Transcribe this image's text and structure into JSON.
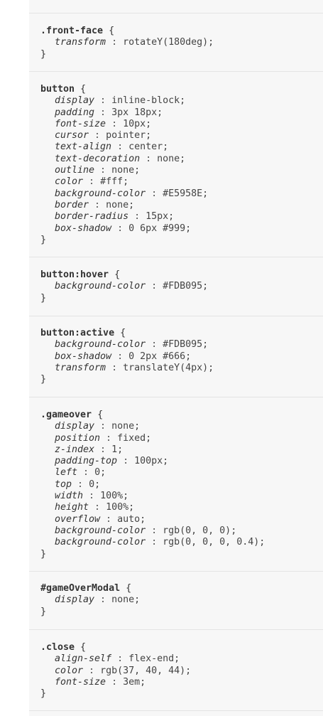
{
  "rules": [
    {
      "selector": ".front-face",
      "declarations": [
        {
          "property": "transform",
          "value": "rotateY(180deg);"
        }
      ]
    },
    {
      "selector": "button",
      "declarations": [
        {
          "property": "display",
          "value": "inline-block;"
        },
        {
          "property": "padding",
          "value": "3px 18px;"
        },
        {
          "property": "font-size",
          "value": "10px;"
        },
        {
          "property": "cursor",
          "value": "pointer;"
        },
        {
          "property": "text-align",
          "value": "center;"
        },
        {
          "property": "text-decoration",
          "value": "none;"
        },
        {
          "property": "outline",
          "value": "none;"
        },
        {
          "property": "color",
          "value": "#fff;"
        },
        {
          "property": "background-color",
          "value": "#E5958E;"
        },
        {
          "property": "border",
          "value": "none;"
        },
        {
          "property": "border-radius",
          "value": "15px;"
        },
        {
          "property": "box-shadow",
          "value": "0 6px #999;"
        }
      ]
    },
    {
      "selector": "button:hover",
      "declarations": [
        {
          "property": "background-color",
          "value": "#FDB095;"
        }
      ]
    },
    {
      "selector": "button:active",
      "declarations": [
        {
          "property": "background-color",
          "value": "#FDB095;"
        },
        {
          "property": "box-shadow",
          "value": "0 2px #666;"
        },
        {
          "property": "transform",
          "value": "translateY(4px);"
        }
      ]
    },
    {
      "selector": ".gameover",
      "declarations": [
        {
          "property": "display",
          "value": "none;"
        },
        {
          "property": "position",
          "value": "fixed;"
        },
        {
          "property": "z-index",
          "value": "1;"
        },
        {
          "property": "padding-top",
          "value": "100px;"
        },
        {
          "property": "left",
          "value": "0;"
        },
        {
          "property": "top",
          "value": "0;"
        },
        {
          "property": "width",
          "value": "100%;"
        },
        {
          "property": "height",
          "value": "100%;"
        },
        {
          "property": "overflow",
          "value": "auto;"
        },
        {
          "property": "background-color",
          "value": "rgb(0, 0, 0);"
        },
        {
          "property": "background-color",
          "value": "rgb(0, 0, 0, 0.4);"
        }
      ]
    },
    {
      "selector": "#gameOverModal",
      "declarations": [
        {
          "property": "display",
          "value": "none;"
        }
      ]
    },
    {
      "selector": ".close",
      "declarations": [
        {
          "property": "align-self",
          "value": "flex-end;"
        },
        {
          "property": "color",
          "value": "rgb(37, 40, 44);"
        },
        {
          "property": "font-size",
          "value": "3em;"
        }
      ]
    }
  ]
}
